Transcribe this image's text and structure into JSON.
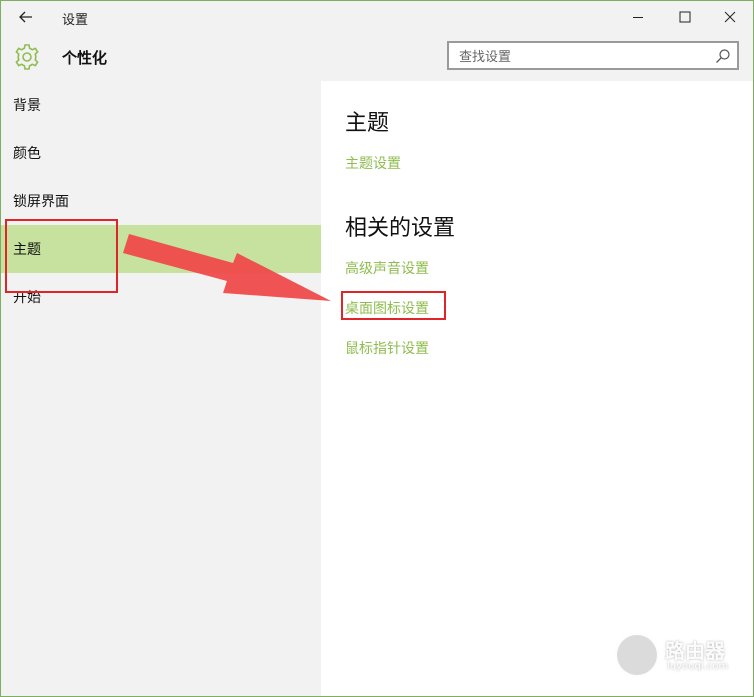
{
  "titlebar": {
    "back_icon": "arrow-left-icon",
    "title": "设置",
    "controls": [
      "minimize-icon",
      "maximize-icon",
      "close-icon"
    ]
  },
  "header": {
    "icon": "gear-icon",
    "title": "个性化",
    "search_placeholder": "查找设置",
    "search_icon": "search-icon"
  },
  "sidebar": {
    "items": [
      {
        "label": "背景"
      },
      {
        "label": "颜色"
      },
      {
        "label": "锁屏界面"
      },
      {
        "label": "主题",
        "selected": true
      },
      {
        "label": "开始"
      }
    ]
  },
  "content": {
    "section1_title": "主题",
    "theme_settings_link": "主题设置",
    "section2_title": "相关的设置",
    "related_links": [
      "高级声音设置",
      "桌面图标设置",
      "鼠标指针设置"
    ]
  },
  "colors": {
    "accent": "#8fbd4f",
    "selected_bg": "#c6e29e",
    "annotation": "#e0252a"
  },
  "watermark": {
    "text": "路由器",
    "sub": "luyouqi.com"
  }
}
